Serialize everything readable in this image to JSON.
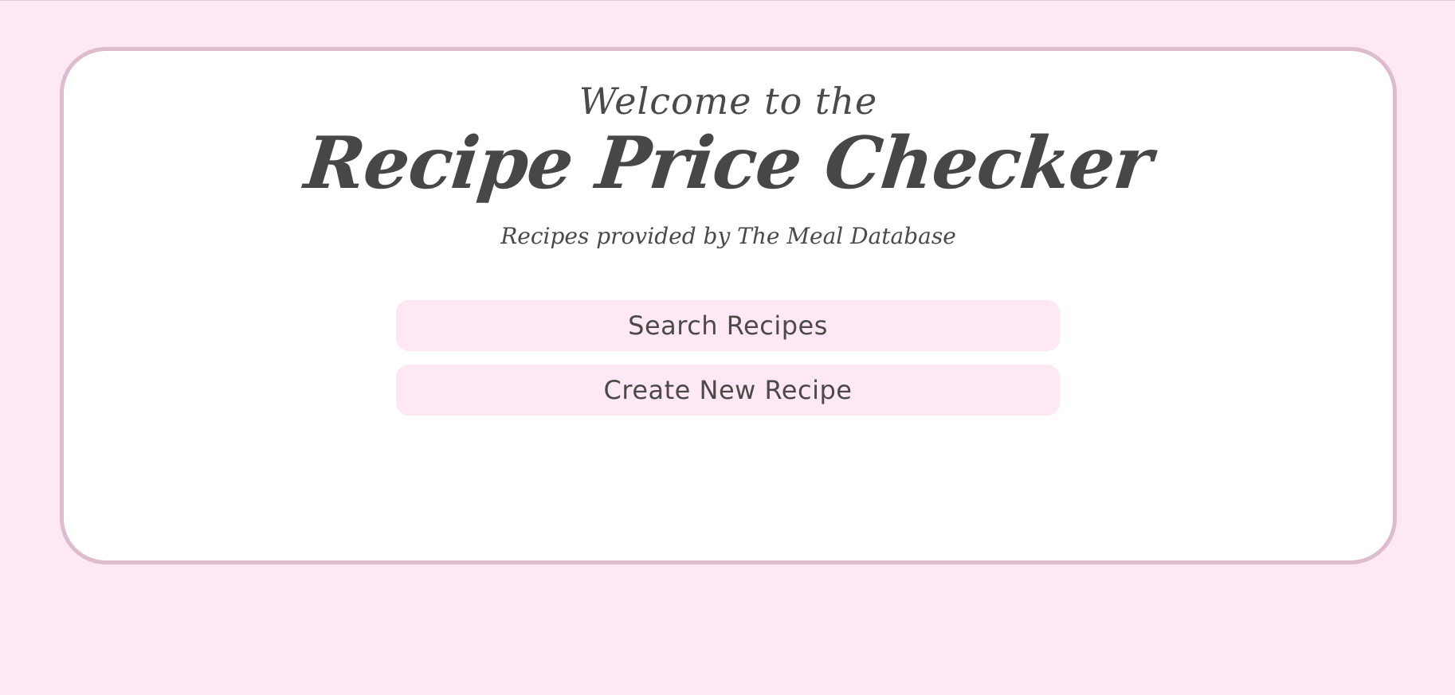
{
  "header": {
    "welcome": "Welcome to the",
    "title": "Recipe Price Checker",
    "subtitle": "Recipes provided by The Meal Database"
  },
  "actions": {
    "search_label": "Search Recipes",
    "create_label": "Create New Recipe"
  },
  "colors": {
    "background": "#fde8f3",
    "card_border": "#dcbccd",
    "card_background": "#ffffff",
    "button_background": "#fde8f3",
    "text": "#4a4a4a"
  }
}
